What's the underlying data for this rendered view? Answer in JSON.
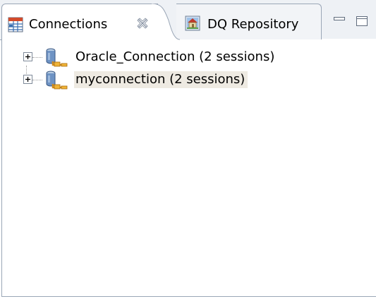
{
  "tabs": [
    {
      "label": "Connections",
      "icon": "connections-table-icon",
      "active": true
    },
    {
      "label": "DQ Repository",
      "icon": "repository-house-icon",
      "active": false
    }
  ],
  "tree": {
    "items": [
      {
        "label": "Oracle_Connection (2 sessions)",
        "icon": "database-connection-icon",
        "expanded": false,
        "selected": false
      },
      {
        "label": "myconnection (2 sessions)",
        "icon": "database-connection-icon",
        "expanded": false,
        "selected": true
      }
    ]
  },
  "colors": {
    "selection": "#eeeae2",
    "border": "#9aa6b6",
    "tab_strip": "#eef1f5"
  }
}
